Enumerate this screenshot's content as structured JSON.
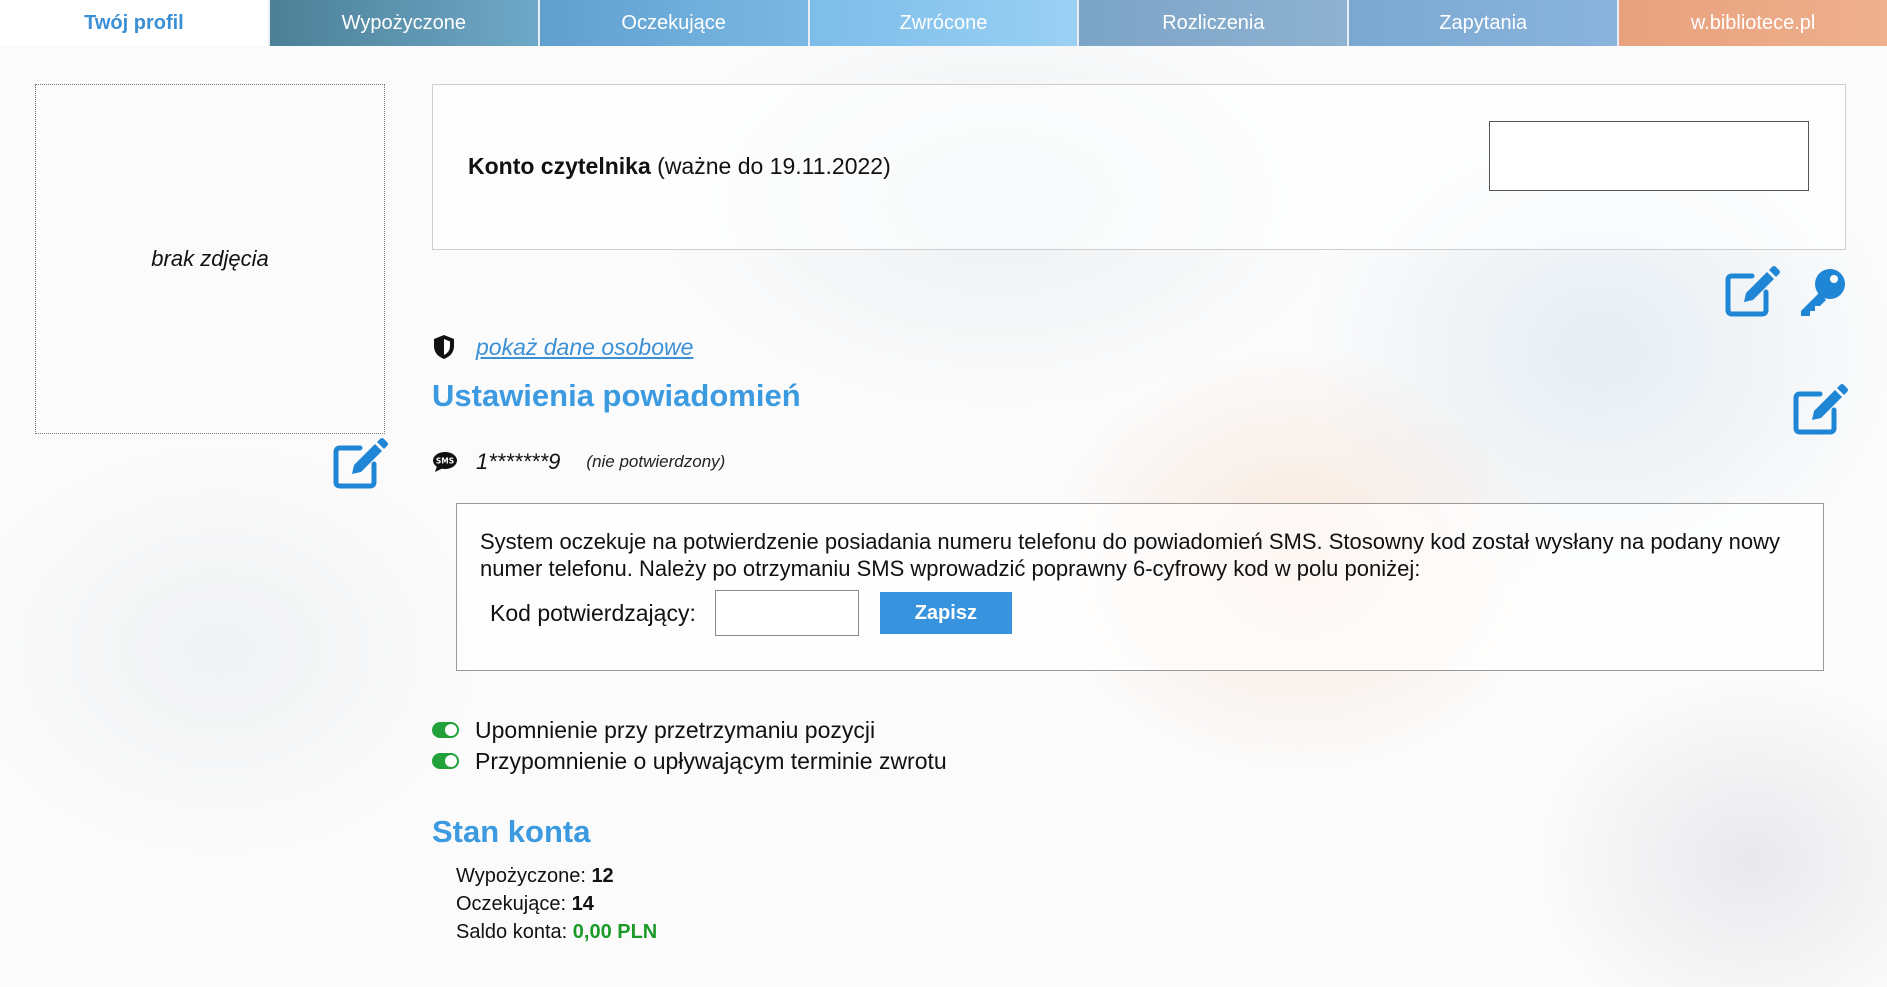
{
  "tabs": [
    {
      "label": "Twój profil",
      "active": true
    },
    {
      "label": "Wypożyczone"
    },
    {
      "label": "Oczekujące"
    },
    {
      "label": "Zwrócone"
    },
    {
      "label": "Rozliczenia"
    },
    {
      "label": "Zapytania"
    },
    {
      "label": "w.bibliotece.pl"
    }
  ],
  "photo": {
    "placeholder": "brak zdjęcia"
  },
  "account": {
    "title": "Konto czytelnika",
    "validity": "(ważne do 19.11.2022)"
  },
  "personal": {
    "show_link": "pokaż dane osobowe"
  },
  "notifications": {
    "heading": "Ustawienia powiadomień",
    "phone": "1*******9",
    "phone_status": "(nie potwierdzony)",
    "notice_text": "System oczekuje na potwierdzenie posiadania numeru telefonu do powiadomień SMS. Stosowny kod został wysłany na podany nowy numer telefonu. Należy po otrzymaniu SMS wprowadzić poprawny 6-cyfrowy kod w polu poniżej:",
    "code_label": "Kod potwierdzający:",
    "save_label": "Zapisz",
    "toggles": [
      {
        "label": "Upomnienie przy przetrzymaniu pozycji",
        "on": true
      },
      {
        "label": "Przypomnienie o upływającym terminie zwrotu",
        "on": true
      }
    ]
  },
  "account_status": {
    "heading": "Stan konta",
    "borrowed_label": "Wypożyczone:",
    "borrowed_value": "12",
    "pending_label": "Oczekujące:",
    "pending_value": "14",
    "balance_label": "Saldo konta:",
    "balance_value": "0,00 PLN"
  },
  "colors": {
    "accent": "#3b9ae0",
    "button": "#3793dd",
    "toggle_on": "#22a13a",
    "balance": "#1b9a2a"
  },
  "icons": [
    "edit-icon",
    "key-icon",
    "shield-icon",
    "sms-icon"
  ]
}
